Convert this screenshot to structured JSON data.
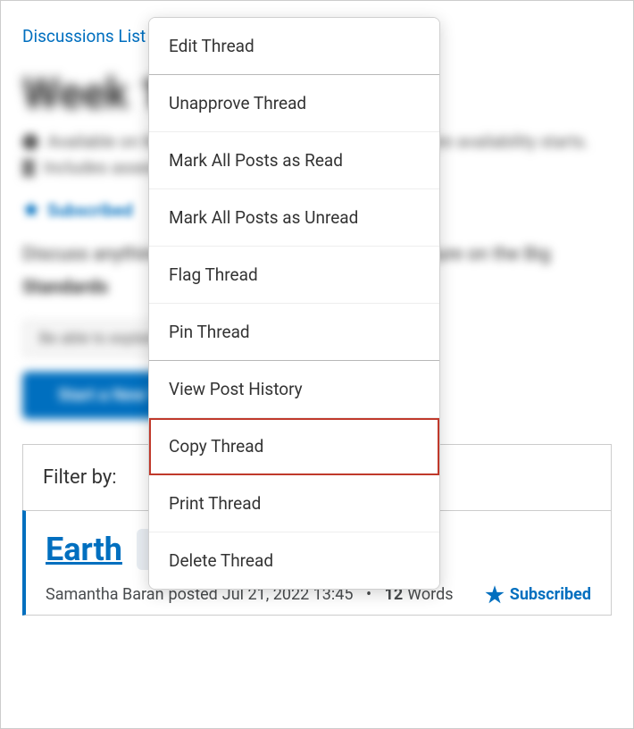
{
  "breadcrumb": {
    "text": "Discussions List"
  },
  "page_title": "Week 1 Discussion",
  "meta": {
    "line1": "Available on March 13, 2025. Access restricted before availability starts.",
    "line2": "Includes assessment"
  },
  "subscribed_top": "Subscribed",
  "description_text": "Discuss anything that interested you from our lecture on the Big",
  "standards_label": "Standards",
  "chip_text": "Be able to explain",
  "primary_button": "Start a New Thread",
  "filter_label": "Filter by:",
  "thread": {
    "title": "Earth",
    "author": "Samantha Baran",
    "posted_verb": "posted",
    "posted_at": "Jul 21, 2022 13:45",
    "separator": "•",
    "word_count": "12",
    "words_label": "Words",
    "subscribed": "Subscribed"
  },
  "menu": {
    "items": [
      {
        "label": "Edit Thread",
        "sep": true,
        "hl": false
      },
      {
        "label": "Unapprove Thread",
        "sep": false,
        "hl": false
      },
      {
        "label": "Mark All Posts as Read",
        "sep": false,
        "hl": false
      },
      {
        "label": "Mark All Posts as Unread",
        "sep": false,
        "hl": false
      },
      {
        "label": "Flag Thread",
        "sep": false,
        "hl": false
      },
      {
        "label": "Pin Thread",
        "sep": true,
        "hl": false
      },
      {
        "label": "View Post History",
        "sep": false,
        "hl": false
      },
      {
        "label": "Copy Thread",
        "sep": false,
        "hl": true
      },
      {
        "label": "Print Thread",
        "sep": false,
        "hl": false
      },
      {
        "label": "Delete Thread",
        "sep": false,
        "hl": false
      }
    ]
  }
}
